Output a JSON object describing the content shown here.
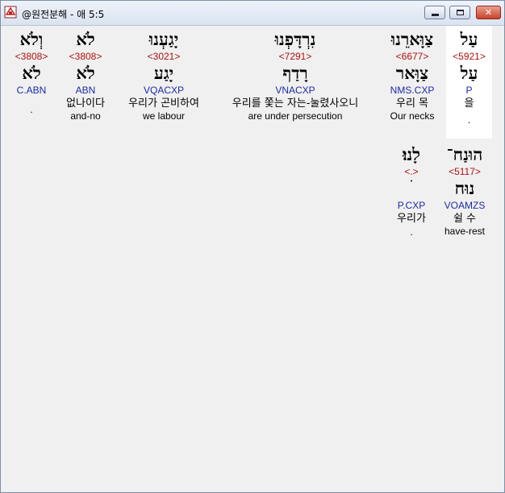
{
  "window": {
    "title": "@원전분해 - 애 5:5",
    "min_label": "minimize",
    "max_label": "maximize",
    "close_glyph": "✕"
  },
  "words": [
    {
      "heb": "עַל",
      "strong": "<5921>",
      "lemma": "עַל",
      "parse": "P",
      "ko": "을",
      "en": "",
      "note": "."
    },
    {
      "heb": "צַוָּארֵנוּ",
      "strong": "<6677>",
      "lemma": "צַוָּאר",
      "parse": "NMS.CXP",
      "ko": "우리 목",
      "en": "Our necks",
      "note": ""
    },
    {
      "heb": "נִרְדָּפְנוּ",
      "strong": "<7291>",
      "lemma": "רָדַף",
      "parse": "VNACXP",
      "ko": "우리를 쫓는 자는-눌렸사오니",
      "en": "are under persecution",
      "note": ""
    },
    {
      "heb": "יָגַעְנוּ",
      "strong": "<3021>",
      "lemma": "יָגַע",
      "parse": "VQACXP",
      "ko": "우리가 곤비하여",
      "en": "we labour",
      "note": ""
    },
    {
      "heb": "לֹא",
      "strong": "<3808>",
      "lemma": "לֹא",
      "parse": "ABN",
      "ko": "없나이다",
      "en": "and-no",
      "note": ""
    },
    {
      "heb": "וְלֹא",
      "strong": "<3808>",
      "lemma": "לֹא",
      "parse": "C.ABN",
      "ko": "",
      "en": "",
      "note": "."
    },
    {
      "heb": "הוּנַח־",
      "strong": "<5117>",
      "lemma": "נוּח",
      "parse": "VOAMZS",
      "ko": "쉴 수",
      "en": "have-rest",
      "note": ""
    },
    {
      "heb": "לָנוּ׃",
      "strong": "<.>",
      "lemma": "ׄ",
      "parse": "P.CXP",
      "ko": "우리가",
      "en": "",
      "note": "."
    }
  ]
}
